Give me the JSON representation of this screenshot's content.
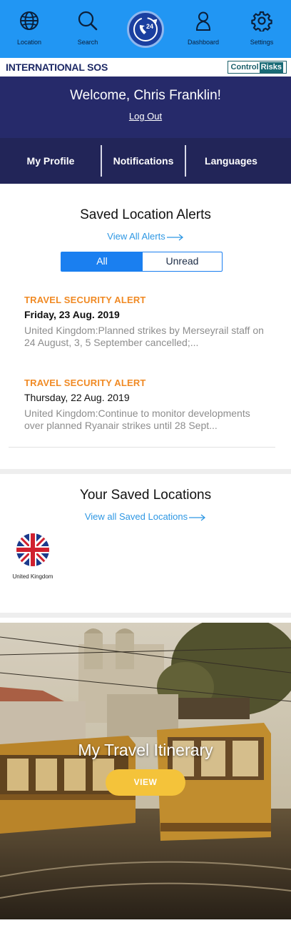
{
  "topnav": {
    "items": [
      {
        "label": "Location",
        "icon": "globe-icon"
      },
      {
        "label": "Search",
        "icon": "search-icon"
      },
      {
        "label": "",
        "icon": "24-hour-phone-icon"
      },
      {
        "label": "Dashboard",
        "icon": "person-icon"
      },
      {
        "label": "Settings",
        "icon": "gear-icon"
      }
    ],
    "center_badge_text": "24"
  },
  "brand": {
    "left": "INTERNATIONAL SOS",
    "right_part1": "Control",
    "right_part2": "Risks"
  },
  "welcome": {
    "title": "Welcome, Chris Franklin!",
    "logout": "Log Out"
  },
  "menu": {
    "items": [
      "My Profile",
      "Notifications",
      "Languages"
    ]
  },
  "alerts": {
    "title": "Saved Location Alerts",
    "view_all": "View All Alerts",
    "tabs": {
      "all": "All",
      "unread": "Unread",
      "selected": "All"
    },
    "items": [
      {
        "type": "TRAVEL SECURITY ALERT",
        "date": "Friday, 23 Aug. 2019",
        "text": "United Kingdom:Planned strikes by Merseyrail staff on 24 August, 3, 5 September cancelled;..."
      },
      {
        "type": "TRAVEL SECURITY ALERT",
        "date": "Thursday, 22 Aug. 2019",
        "text": "United Kingdom:Continue to monitor developments over planned Ryanair strikes until 28 Sept..."
      }
    ]
  },
  "locations": {
    "title": "Your Saved Locations",
    "view_all": "View all Saved Locations",
    "items": [
      {
        "name": "United Kingdom",
        "icon": "uk-flag-icon"
      }
    ]
  },
  "itinerary": {
    "title": "My Travel Itinerary",
    "button": "VIEW"
  },
  "colors": {
    "nav_blue": "#2196f3",
    "welcome_navy": "#262a6a",
    "alert_orange": "#f08a24",
    "link_blue": "#2e97e3",
    "button_yellow": "#f4c33a"
  }
}
